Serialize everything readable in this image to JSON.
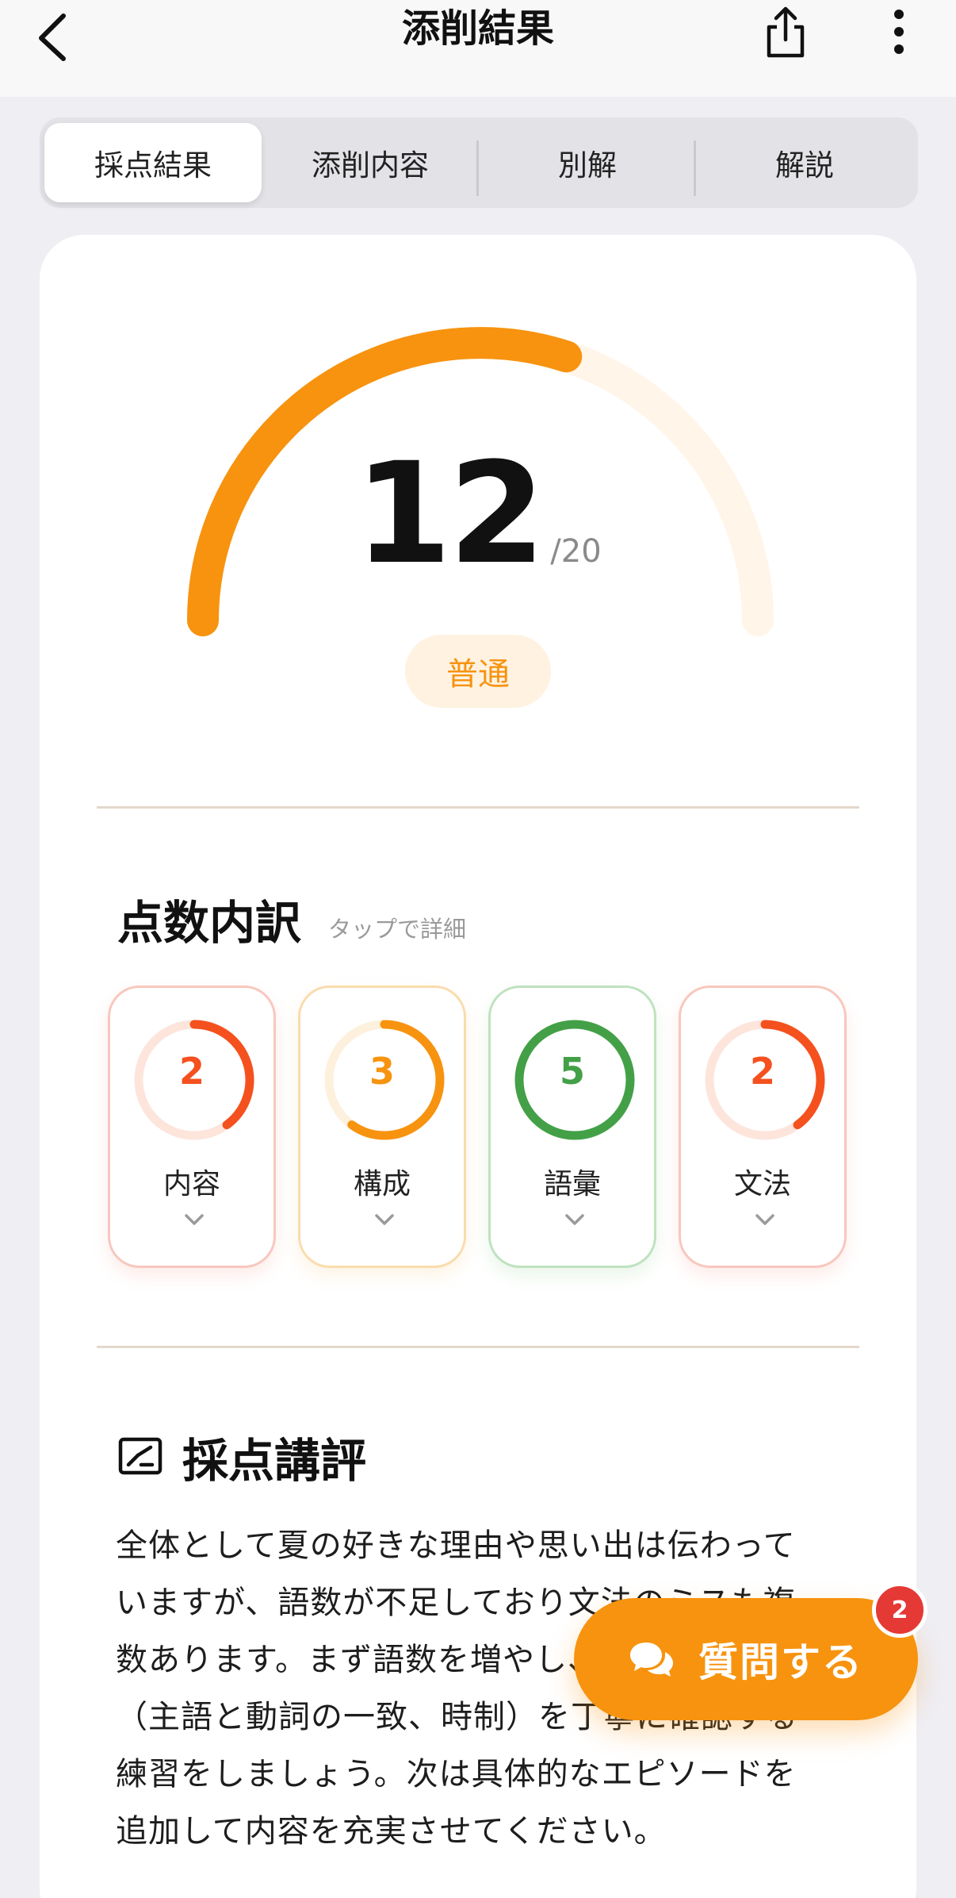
{
  "header": {
    "title": "添削結果",
    "back_icon": "chevron-left-icon",
    "share_icon": "share-icon",
    "more_icon": "more-vertical-icon"
  },
  "tabs": [
    {
      "label": "採点結果",
      "active": true
    },
    {
      "label": "添削内容",
      "active": false
    },
    {
      "label": "別解",
      "active": false
    },
    {
      "label": "解説",
      "active": false
    }
  ],
  "score": {
    "value": "12",
    "max": "/20",
    "fraction": 0.6,
    "level": "普通",
    "accent_color": "#f7930f"
  },
  "breakdown": {
    "title": "点数内訳",
    "hint": "タップで詳細",
    "items": [
      {
        "label": "内容",
        "score": "2",
        "fraction": 0.4,
        "color": "#f4511e",
        "track": "#fde5dc",
        "border": "#f8c7bd"
      },
      {
        "label": "構成",
        "score": "3",
        "fraction": 0.6,
        "color": "#f7930f",
        "track": "#fdf0dd",
        "border": "#f9dcad"
      },
      {
        "label": "語彙",
        "score": "5",
        "fraction": 1.0,
        "color": "#43a047",
        "track": "#e3f1e3",
        "border": "#bfe2bf"
      },
      {
        "label": "文法",
        "score": "2",
        "fraction": 0.4,
        "color": "#f4511e",
        "track": "#fde5dc",
        "border": "#f8c7bd"
      }
    ]
  },
  "comment": {
    "title": "採点講評",
    "icon": "edit-comment-icon",
    "text": "全体として夏の好きな理由や思い出は伝わっていますが、語数が不足しており文法のミスも複数あります。まず語数を増やし、文法の基本（主語と動詞の一致、時制）を丁寧に確認する練習をしましょう。次は具体的なエピソードを追加して内容を充実させてください。"
  },
  "ask_button": {
    "label": "質問する",
    "icon": "chat-bubbles-icon",
    "badge": "2"
  }
}
